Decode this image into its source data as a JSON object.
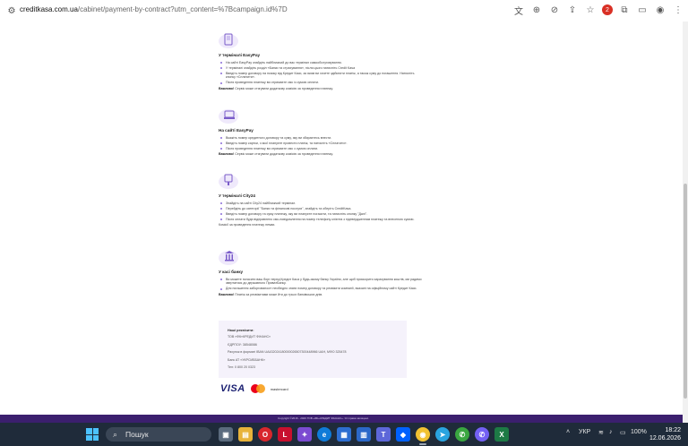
{
  "browser": {
    "url_domain": "creditkasa.com.ua",
    "url_path": "/cabinet/payment-by-contract?utm_content=%7Bcampaign.id%7D",
    "extension_badge": "2"
  },
  "sections": [
    {
      "icon": "phone-terminal-icon",
      "title": "У терміналі EasyPay",
      "items": [
        "На сайті EasyPay знайдіть найближчий до вас термінал самообслуговування.",
        "У терміналі знайдіть розділ «Банки та страхування», після цього натисніть Credit Kasa",
        "Введіть номер договору на позику від Кредит Каси, за яким ви хочете здійснити платіж, а також суму до погашення. Натисніть кнопку «Сплатити».",
        "Після проведення платежу ви отримаєте смс із сумою оплати."
      ],
      "note_label": "Важливо!",
      "note_text": " Сервіс може стягувати додаткову комісію за проведення платежу."
    },
    {
      "icon": "laptop-icon",
      "title": "На сайті EasyPay",
      "items": [
        "Вкажіть номер кредитного договору та суму, яку ви збираєтесь внести.",
        "Введіть номер картки, з якої плануєте провести платіж, та натисніть «Сплатити».",
        "Після проведення платежу ви отримаєте смс з сумою оплати."
      ],
      "note_label": "Важливо!",
      "note_text": " Сервіс може стягувати додаткову комісію за проведення платежу."
    },
    {
      "icon": "terminal-icon",
      "title": "У терміналі City24",
      "items": [
        "Знайдіть на сайті City24 найближчий термінал.",
        "Перейдіть до категорії \"Банки та фінансові послуги\", знайдіть та оберіть CreditKasa.",
        "Введіть номер договору та суму платежу, яку ви плануєте погасити, та натисніть кнопку \"Далі\".",
        "Після оплати будє відправлено смс-повідомлення на номер телефону клієнта з підтвердженням платежу та внесеною сумою."
      ],
      "note_label": "",
      "note_text": "Комісії за проведення платежу немає."
    },
    {
      "icon": "bank-icon",
      "title": "У касі банку",
      "items": [
        "Ви можете погасити ваш борг перед Кредит Каса у будь-якому банку України, але щоб прискорити зарахування коштів, ми радимо звертатися до державного ПриватБанку.",
        "Для погашення заборгованості необхідно знати номер договору та реквізити компанії, вказані на офіційному сайті Кредит Каси."
      ],
      "note_label": "Важливо!",
      "note_text": " Платіж за реквізитами може йти до трьох банківських днів."
    }
  ],
  "details": {
    "title": "Наші реквізити:",
    "lines": [
      "ТОВ «ФК«КРЕДИТ ФІНАНС»",
      "ЄДРПОУ: 38548086",
      "Рахунок в форматі IBAN UA432024180000026507300448966 UAH, МФО 325478",
      "Банк АТ «УКРСИББАНК»",
      "Тел: 0 800 20 0323"
    ]
  },
  "logos": {
    "visa": "VISA",
    "mastercard": "mastercard"
  },
  "footer_text": "Copyright ©2016 - 2026 ТОВ «ФК«КРЕДИТ ФІНАНС». Усі права захищені.",
  "taskbar": {
    "search_label": "Пошук",
    "language": "УКР",
    "battery": "100%",
    "time": "18:22",
    "date": "12.06.2026"
  }
}
